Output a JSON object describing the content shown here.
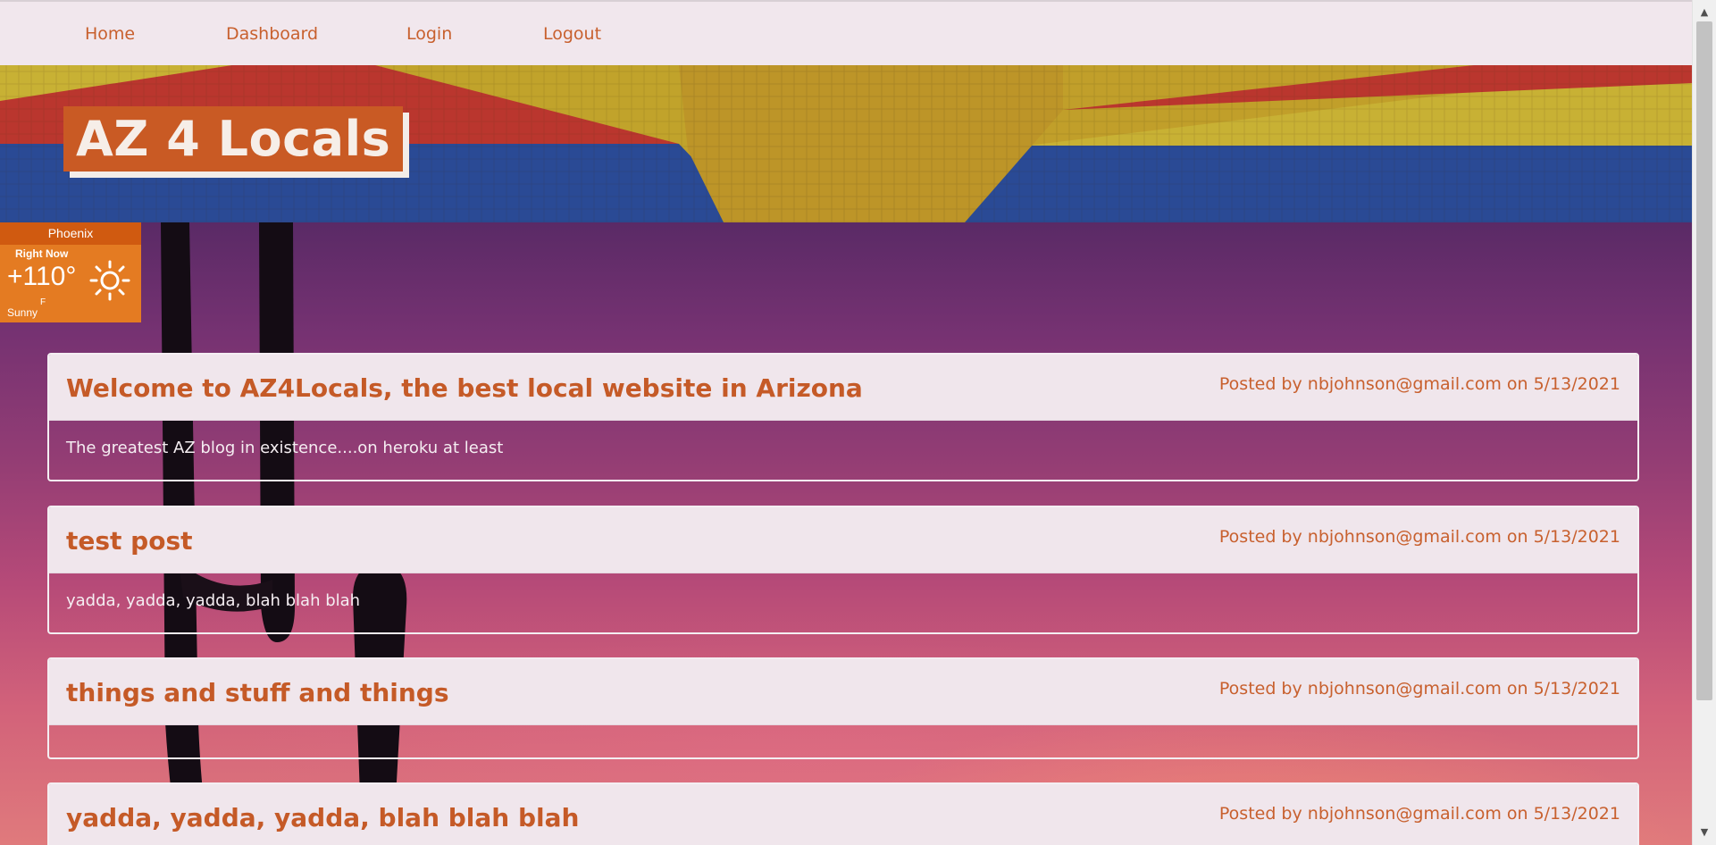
{
  "nav": {
    "items": [
      "Home",
      "Dashboard",
      "Login",
      "Logout"
    ]
  },
  "header": {
    "brand": "AZ 4 Locals"
  },
  "weather": {
    "city": "Phoenix",
    "label": "Right Now",
    "temperature": "+110°",
    "unit": "F",
    "condition": "Sunny",
    "icon": "sun-icon"
  },
  "posts": [
    {
      "title": "Welcome to AZ4Locals, the best local website in Arizona",
      "meta": "Posted by nbjohnson@gmail.com on 5/13/2021",
      "body": "The greatest AZ blog in existence....on heroku at least"
    },
    {
      "title": "test post",
      "meta": "Posted by nbjohnson@gmail.com on 5/13/2021",
      "body": "yadda, yadda, yadda, blah blah blah"
    },
    {
      "title": "things and stuff and things",
      "meta": "Posted by nbjohnson@gmail.com on 5/13/2021",
      "body": ""
    },
    {
      "title": "yadda, yadda, yadda, blah blah blah",
      "meta": "Posted by nbjohnson@gmail.com on 5/13/2021",
      "body": ""
    }
  ],
  "colors": {
    "accent": "#c55a27",
    "nav_bg": "#f1e7ed",
    "weather_bg": "#e47b22"
  }
}
